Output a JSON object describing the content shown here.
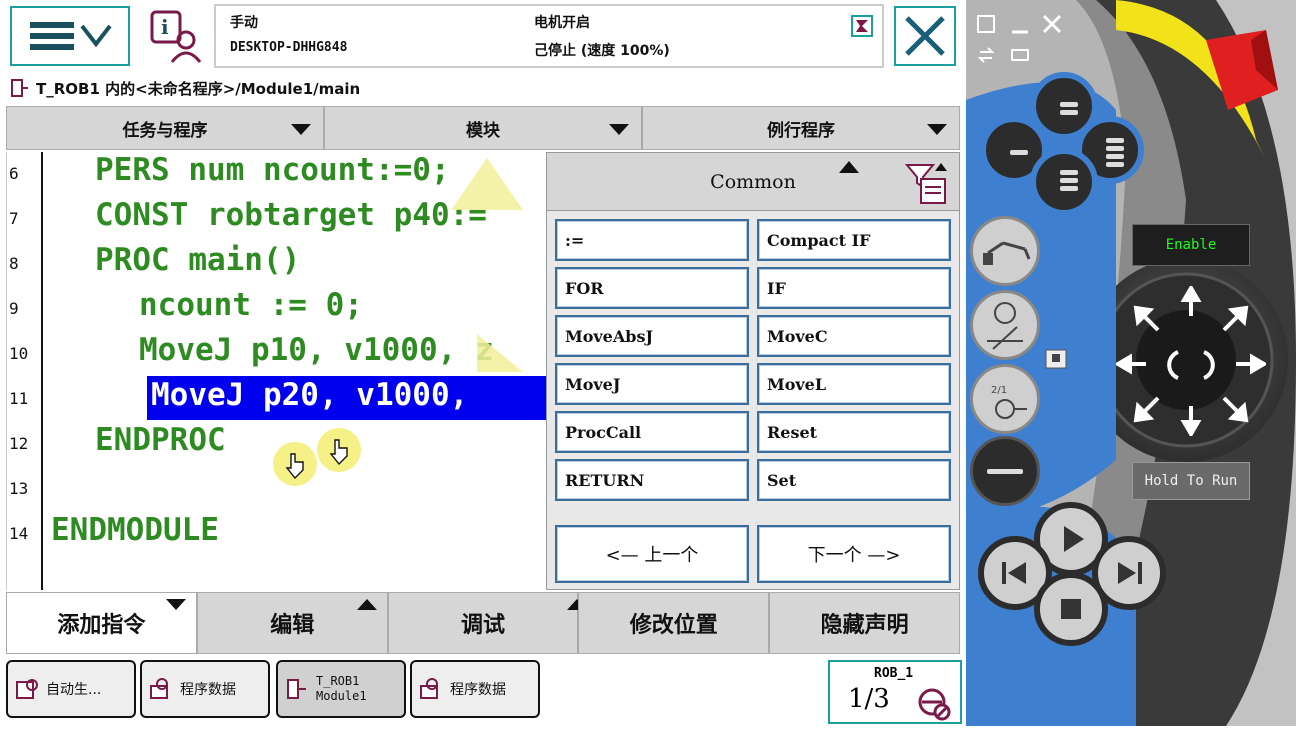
{
  "status": {
    "mode": "手动",
    "controller": "DESKTOP-DHHG848",
    "motor": "电机开启",
    "state": "己停止 (速度 100%)"
  },
  "path": "T_ROB1 内的<未命名程序>/Module1/main",
  "tabs": [
    {
      "label": "任务与程序"
    },
    {
      "label": "模块"
    },
    {
      "label": "例行程序"
    }
  ],
  "code_lines": [
    {
      "num": "6",
      "text": "PERS num ncount:=0;"
    },
    {
      "num": "7",
      "text": "CONST robtarget p40:="
    },
    {
      "num": "8",
      "text": "PROC main()"
    },
    {
      "num": "9",
      "text": "ncount := 0;"
    },
    {
      "num": "10",
      "text": "MoveJ p10, v1000, z"
    },
    {
      "num": "11",
      "text": "MoveJ p20, v1000,"
    },
    {
      "num": "12",
      "text": "ENDPROC"
    },
    {
      "num": "13",
      "text": ""
    },
    {
      "num": "14",
      "text": "ENDMODULE"
    }
  ],
  "panel": {
    "title": "Common",
    "buttons": [
      ":=",
      "Compact IF",
      "FOR",
      "IF",
      "MoveAbsJ",
      "MoveC",
      "MoveJ",
      "MoveL",
      "ProcCall",
      "Reset",
      "RETURN",
      "Set"
    ],
    "prev": "<—  上一个",
    "next": "下一个  —>"
  },
  "bottom_menu": [
    {
      "label": "添加指令"
    },
    {
      "label": "编辑"
    },
    {
      "label": "调试"
    },
    {
      "label": "修改位置"
    },
    {
      "label": "隐藏声明"
    }
  ],
  "taskbar": [
    {
      "label": "自动生..."
    },
    {
      "label": "程序数据"
    },
    {
      "label1": "T_ROB1",
      "label2": "Module1"
    },
    {
      "label": "程序数据"
    }
  ],
  "rob": {
    "name": "ROB_1",
    "fraction": "1/3"
  },
  "pendant": {
    "enable": "Enable",
    "hold": "Hold To Run"
  },
  "colors": {
    "accent": "#1aa0a0",
    "code": "#2e8b22",
    "selection": "#0000ee",
    "pendant_blue": "#3f7fd0",
    "estop": "#e02020",
    "yellow": "#f2e21a"
  }
}
